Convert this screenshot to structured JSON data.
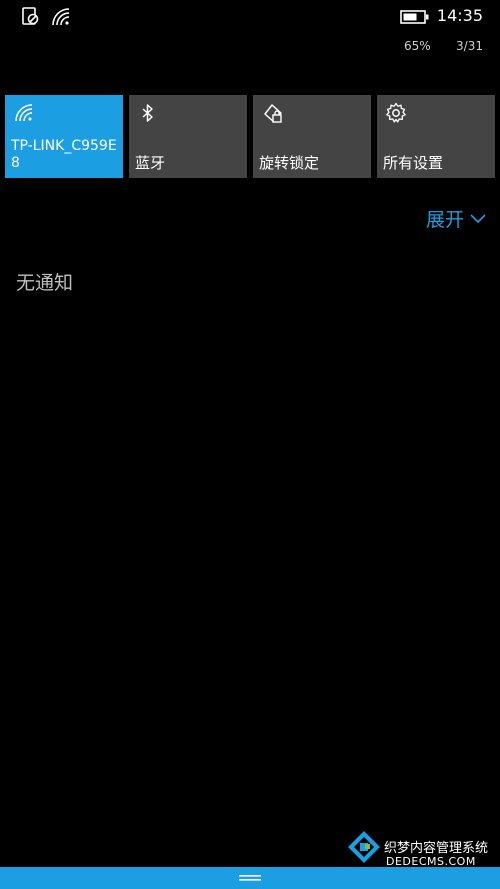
{
  "status_bar": {
    "time": "14:35",
    "battery_percent": "65%",
    "date": "3/31",
    "icons": [
      "do-not-disturb-icon",
      "wifi-icon",
      "battery-icon"
    ]
  },
  "quick_actions": [
    {
      "label": "TP-LINK_C959E8",
      "icon": "wifi-icon",
      "active": true
    },
    {
      "label": "蓝牙",
      "icon": "bluetooth-icon",
      "active": false
    },
    {
      "label": "旋转锁定",
      "icon": "rotation-lock-icon",
      "active": false
    },
    {
      "label": "所有设置",
      "icon": "gear-icon",
      "active": false
    }
  ],
  "expand": {
    "label": "展开",
    "icon": "chevron-down-icon"
  },
  "notifications": {
    "empty_text": "无通知"
  },
  "bottom_bar": {
    "icon": "handle-icon"
  },
  "watermark": {
    "line1": "织梦内容管理系统",
    "line2": "DEDECMS.COM"
  },
  "colors": {
    "accent": "#1c9ee2",
    "tile": "#444444",
    "background": "#000000"
  }
}
